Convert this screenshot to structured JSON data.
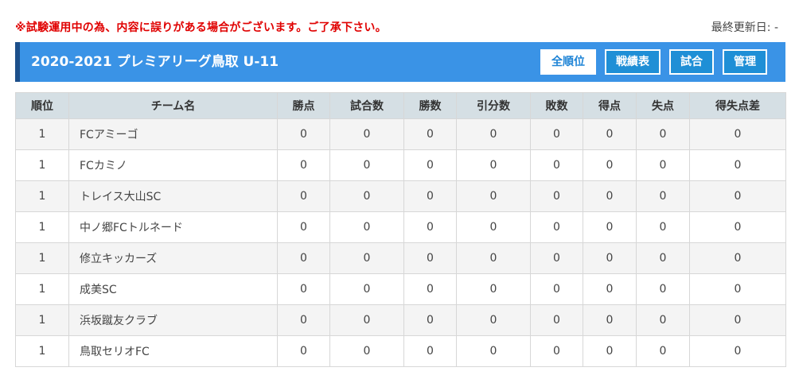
{
  "notice": "※試験運用中の為、内容に誤りがある場合がございます。ご了承下さい。",
  "last_updated": "最終更新日: -",
  "header": {
    "title": "2020-2021 プレミアリーグ鳥取 U-11",
    "nav": [
      {
        "label": "全順位",
        "active": true
      },
      {
        "label": "戦績表",
        "active": false
      },
      {
        "label": "試合",
        "active": false
      },
      {
        "label": "管理",
        "active": false
      }
    ]
  },
  "table": {
    "columns": [
      "順位",
      "チーム名",
      "勝点",
      "試合数",
      "勝数",
      "引分数",
      "敗数",
      "得点",
      "失点",
      "得失点差"
    ],
    "rows": [
      [
        "1",
        "FCアミーゴ",
        "0",
        "0",
        "0",
        "0",
        "0",
        "0",
        "0",
        "0"
      ],
      [
        "1",
        "FCカミノ",
        "0",
        "0",
        "0",
        "0",
        "0",
        "0",
        "0",
        "0"
      ],
      [
        "1",
        "トレイス大山SC",
        "0",
        "0",
        "0",
        "0",
        "0",
        "0",
        "0",
        "0"
      ],
      [
        "1",
        "中ノ郷FCトルネード",
        "0",
        "0",
        "0",
        "0",
        "0",
        "0",
        "0",
        "0"
      ],
      [
        "1",
        "修立キッカーズ",
        "0",
        "0",
        "0",
        "0",
        "0",
        "0",
        "0",
        "0"
      ],
      [
        "1",
        "成美SC",
        "0",
        "0",
        "0",
        "0",
        "0",
        "0",
        "0",
        "0"
      ],
      [
        "1",
        "浜坂蹴友クラブ",
        "0",
        "0",
        "0",
        "0",
        "0",
        "0",
        "0",
        "0"
      ],
      [
        "1",
        "鳥取セリオFC",
        "0",
        "0",
        "0",
        "0",
        "0",
        "0",
        "0",
        "0"
      ]
    ]
  },
  "colors": {
    "notice": "#e00000",
    "header_bg": "#3a93e6",
    "header_accent": "#1c4f8a",
    "nav_button_bg": "#1f8fd6",
    "table_header_bg": "#d5dfe4"
  }
}
